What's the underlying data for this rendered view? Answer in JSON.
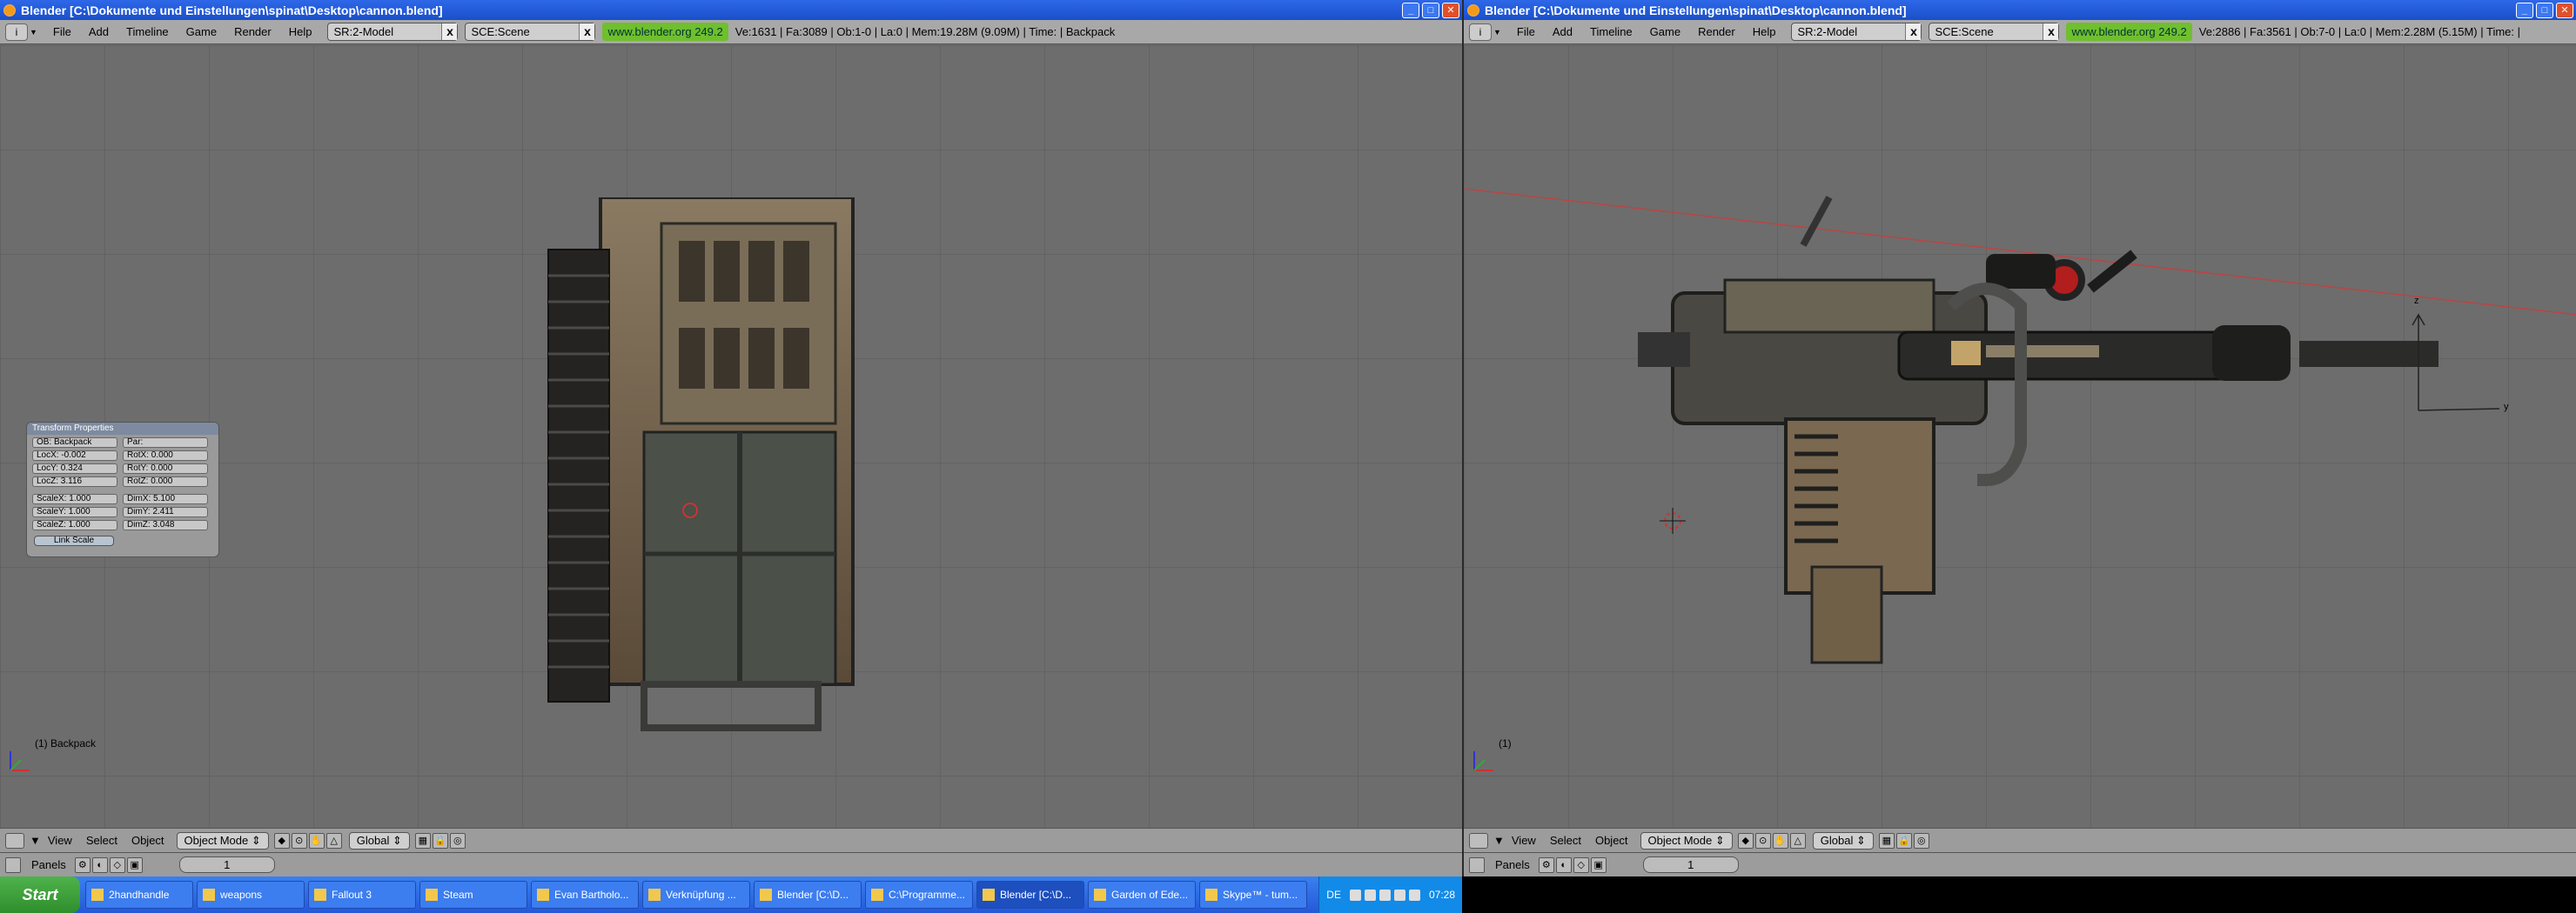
{
  "left": {
    "title": "Blender [C:\\Dokumente und Einstellungen\\spinat\\Desktop\\cannon.blend]",
    "menu": [
      "File",
      "Add",
      "Timeline",
      "Game",
      "Render",
      "Help"
    ],
    "screen_field": "SR:2-Model",
    "scene_field": "SCE:Scene",
    "url": "www.blender.org 249.2",
    "stats": "Ve:1631 | Fa:3089 | Ob:1-0 | La:0  | Mem:19.28M (9.09M)  | Time: | Backpack",
    "object_label": "(1) Backpack",
    "header_menu": [
      "View",
      "Select",
      "Object"
    ],
    "mode": "Object Mode",
    "orientation": "Global",
    "panels_label": "Panels",
    "frame": "1",
    "transform_panel": {
      "title": "Transform Properties",
      "ob": "OB: Backpack",
      "par": "Par:",
      "loc_x": "LocX: -0.002",
      "loc_y": "LocY: 0.324",
      "loc_z": "LocZ: 3.116",
      "rot_x": "RotX: 0.000",
      "rot_y": "RotY: 0.000",
      "rot_z": "RotZ: 0.000",
      "scale_x": "ScaleX: 1.000",
      "scale_y": "ScaleY: 1.000",
      "scale_z": "ScaleZ: 1.000",
      "dim_x": "DimX: 5.100",
      "dim_y": "DimY: 2.411",
      "dim_z": "DimZ: 3.048",
      "link_scale": "Link Scale"
    }
  },
  "right": {
    "title": "Blender [C:\\Dokumente und Einstellungen\\spinat\\Desktop\\cannon.blend]",
    "menu": [
      "File",
      "Add",
      "Timeline",
      "Game",
      "Render",
      "Help"
    ],
    "screen_field": "SR:2-Model",
    "scene_field": "SCE:Scene",
    "url": "www.blender.org 249.2",
    "stats": "Ve:2886 | Fa:3561 | Ob:7-0 | La:0  | Mem:2.28M (5.15M)  | Time: |",
    "object_label": "(1)",
    "header_menu": [
      "View",
      "Select",
      "Object"
    ],
    "mode": "Object Mode",
    "orientation": "Global",
    "panels_label": "Panels",
    "frame": "1",
    "axis_z": "z",
    "axis_y": "y"
  },
  "taskbar": {
    "start": "Start",
    "tasks": [
      "2handhandle",
      "weapons",
      "Fallout 3",
      "Steam",
      "Evan Bartholo...",
      "Verknüpfung ...",
      "Blender [C:\\D...",
      "C:\\Programme...",
      "Blender [C:\\D...",
      "Garden of Ede...",
      "Skype™ - tum..."
    ],
    "lang": "DE",
    "clock": "07:28"
  },
  "colors": {
    "viewport": "#6d6d6d",
    "header": "#9c9c9c",
    "titlebar": "#2e68e8",
    "url_bg": "#6fbf2e"
  }
}
